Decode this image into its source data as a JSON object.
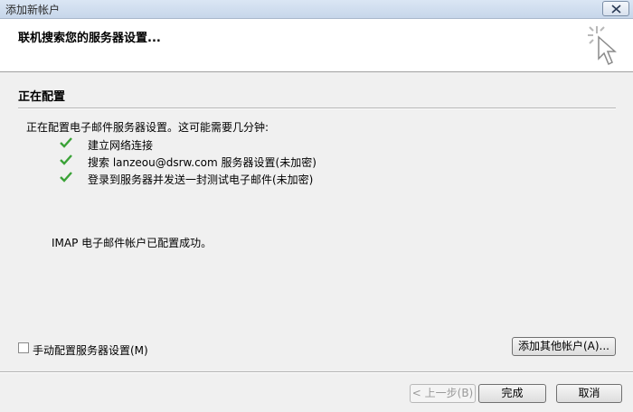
{
  "window": {
    "title": "添加新帐户"
  },
  "header": {
    "title": "联机搜索您的服务器设置..."
  },
  "section": {
    "title": "正在配置"
  },
  "status": {
    "intro": "正在配置电子邮件服务器设置。这可能需要几分钟:",
    "steps": [
      {
        "label": "建立网络连接",
        "done": true
      },
      {
        "label": "搜索 lanzeou@dsrw.com 服务器设置(未加密)",
        "done": true
      },
      {
        "label": "登录到服务器并发送一封测试电子邮件(未加密)",
        "done": true
      }
    ],
    "result": "IMAP 电子邮件帐户已配置成功。"
  },
  "options": {
    "manual_label": "手动配置服务器设置(M)",
    "manual_checked": false,
    "add_other_label": "添加其他帐户(A)..."
  },
  "footer": {
    "back_label": "< 上一步(B)",
    "finish_label": "完成",
    "cancel_label": "取消"
  },
  "colors": {
    "check": "#3aa237",
    "header_bg": "#ffffff",
    "body_bg": "#f0f0f0"
  }
}
